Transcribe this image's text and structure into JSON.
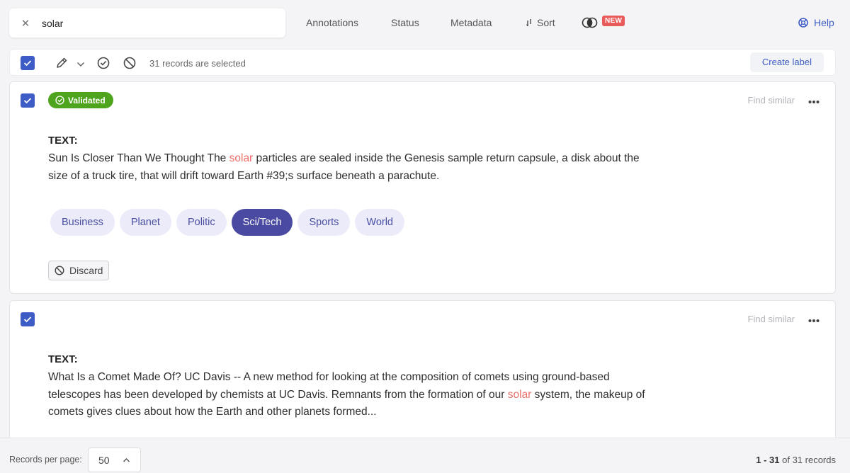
{
  "search": {
    "value": "solar",
    "clear_icon": "close-icon"
  },
  "filters": {
    "annotations": "Annotations",
    "status": "Status",
    "metadata": "Metadata",
    "sort": "Sort",
    "new_badge": "NEW"
  },
  "help": {
    "label": "Help"
  },
  "selection": {
    "count_text": "31 records are selected",
    "create_label": "Create label"
  },
  "records": [
    {
      "status": "Validated",
      "find_similar": "Find similar",
      "text_title": "TEXT:",
      "text_before": "Sun Is Closer Than We Thought The ",
      "text_highlight": "solar",
      "text_after": " particles are sealed inside the Genesis sample return capsule, a disk about the size of a truck tire, that will drift toward Earth #39;s surface beneath a parachute.",
      "labels": [
        "Business",
        "Planet",
        "Politic",
        "Sci/Tech",
        "Sports",
        "World"
      ],
      "selected_label": "Sci/Tech",
      "discard": "Discard"
    },
    {
      "find_similar": "Find similar",
      "text_title": "TEXT:",
      "text_before": "What Is a Comet Made Of? UC Davis -- A new method for looking at the composition of comets using ground-based telescopes has been developed by chemists at UC Davis. Remnants from the formation of our ",
      "text_highlight": "solar",
      "text_after": " system, the makeup of comets gives clues about how the Earth and other planets formed..."
    }
  ],
  "footer": {
    "records_per_page_label": "Records per page:",
    "records_per_page_value": "50",
    "range": "1 - 31",
    "of_text": " of 31 records"
  },
  "colors": {
    "accent": "#3e5cc5",
    "validated": "#4fa41d",
    "highlight": "#ec6e68",
    "label_active": "#4a4aa3",
    "label_inactive": "#ebebfa",
    "new_badge": "#e95a5a"
  }
}
